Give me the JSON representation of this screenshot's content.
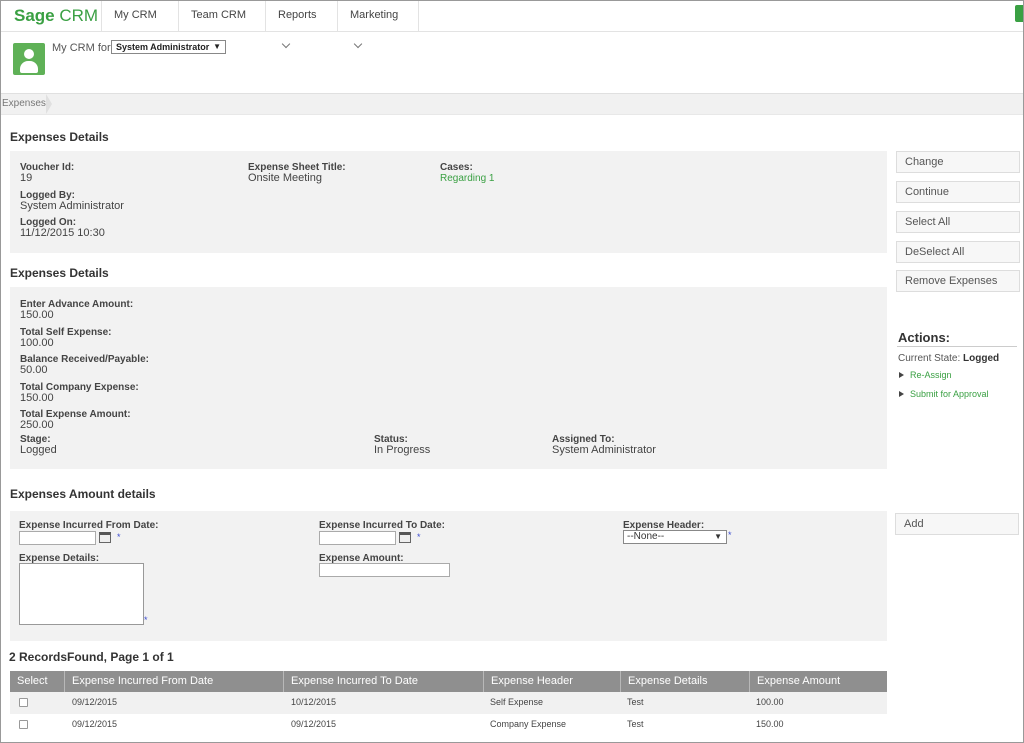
{
  "nav": {
    "logo_bold": "Sage",
    "logo_rest": " CRM",
    "items": [
      {
        "label": "My CRM"
      },
      {
        "label": "Team CRM"
      },
      {
        "label": "Reports"
      },
      {
        "label": "Marketing"
      }
    ]
  },
  "user": {
    "for_label": "My CRM for:",
    "selected": "System Administrator"
  },
  "breadcrumb": "Expenses",
  "details": {
    "title": "Expenses Details",
    "voucher_label": "Voucher Id:",
    "voucher_value": "19",
    "sheet_label": "Expense Sheet Title:",
    "sheet_value": "Onsite Meeting",
    "cases_label": "Cases:",
    "cases_value": "Regarding 1",
    "logged_by_label": "Logged By:",
    "logged_by_value": "System Administrator",
    "logged_on_label": "Logged On:",
    "logged_on_value": "11/12/2015 10:30"
  },
  "summary": {
    "title": "Expenses Details",
    "advance_label": "Enter Advance Amount:",
    "advance_value": "150.00",
    "self_label": "Total Self Expense:",
    "self_value": "100.00",
    "balance_label": "Balance Received/Payable:",
    "balance_value": "50.00",
    "company_label": "Total Company Expense:",
    "company_value": "150.00",
    "total_label": "Total Expense Amount:",
    "total_value": "250.00",
    "stage_label": "Stage:",
    "stage_value": "Logged",
    "status_label": "Status:",
    "status_value": "In Progress",
    "assigned_label": "Assigned To:",
    "assigned_value": "System Administrator"
  },
  "buttons": {
    "change": "Change",
    "continue": "Continue",
    "select_all": "Select All",
    "deselect_all": "DeSelect All",
    "remove": "Remove Expenses",
    "add": "Add"
  },
  "actions": {
    "title": "Actions:",
    "state_label": "Current State:",
    "state_value": "Logged",
    "items": [
      "Re-Assign",
      "Submit for Approval"
    ]
  },
  "amount_form": {
    "title": "Expenses Amount details",
    "from_label": "Expense Incurred From Date:",
    "to_label": "Expense Incurred To Date:",
    "header_label": "Expense Header:",
    "header_selected": "--None--",
    "details_label": "Expense Details:",
    "amount_label": "Expense Amount:",
    "required_mark": "*"
  },
  "records": {
    "summary": "2 RecordsFound, Page 1 of 1",
    "columns": [
      "Select",
      "Expense Incurred From Date",
      "Expense Incurred To Date",
      "Expense Header",
      "Expense Details",
      "Expense Amount"
    ],
    "rows": [
      {
        "from": "09/12/2015",
        "to": "10/12/2015",
        "header": "Self Expense",
        "details": "Test",
        "amount": "100.00"
      },
      {
        "from": "09/12/2015",
        "to": "09/12/2015",
        "header": "Company Expense",
        "details": "Test",
        "amount": "150.00"
      }
    ]
  },
  "colors": {
    "accent": "#3aa043",
    "panel": "#f2f2f2",
    "table_header": "#8f8f8f",
    "required": "#3b4bd0"
  }
}
